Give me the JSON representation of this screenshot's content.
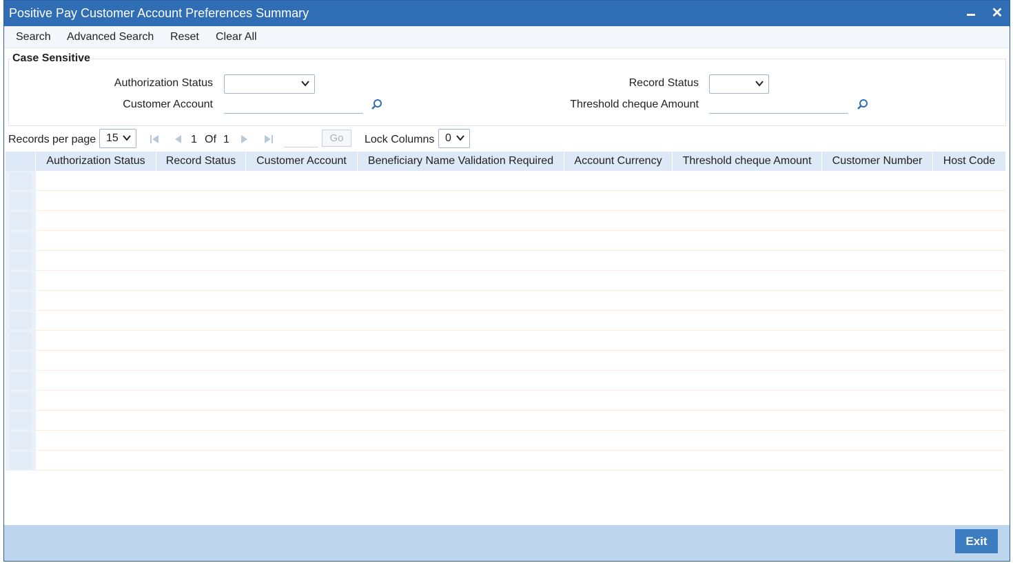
{
  "window": {
    "title": "Positive Pay Customer Account Preferences Summary"
  },
  "menu": {
    "search": "Search",
    "advanced_search": "Advanced Search",
    "reset": "Reset",
    "clear_all": "Clear All"
  },
  "criteria": {
    "legend": "Case Sensitive",
    "authorization_status_label": "Authorization Status",
    "authorization_status_value": "",
    "record_status_label": "Record Status",
    "record_status_value": "",
    "customer_account_label": "Customer Account",
    "customer_account_value": "",
    "threshold_label": "Threshold cheque Amount",
    "threshold_value": ""
  },
  "pager": {
    "records_per_page_label": "Records per page",
    "records_per_page_value": "15",
    "current_page": "1",
    "of_label": "Of",
    "total_pages": "1",
    "go_label": "Go",
    "lock_columns_label": "Lock Columns",
    "lock_columns_value": "0"
  },
  "grid": {
    "columns": [
      "Authorization Status",
      "Record Status",
      "Customer Account",
      "Beneficiary Name Validation Required",
      "Account Currency",
      "Threshold cheque Amount",
      "Customer Number",
      "Host Code"
    ],
    "row_count": 15
  },
  "footer": {
    "exit_label": "Exit"
  },
  "colors": {
    "titlebar": "#2f6db5",
    "footer": "#bdd6ee",
    "header": "#dde9f6",
    "exit_button": "#3c7cc0"
  }
}
